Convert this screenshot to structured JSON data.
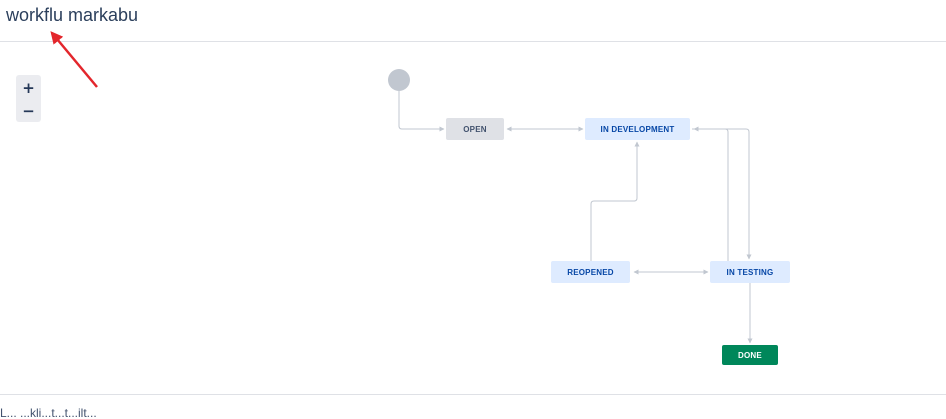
{
  "page": {
    "title": "workflu markabu",
    "footer_text": "L... ...kli...t...t...ilt..."
  },
  "zoom": {
    "zoom_in_label": "+",
    "zoom_out_label": "−"
  },
  "statuses": {
    "open": "OPEN",
    "in_development": "IN DEVELOPMENT",
    "reopened": "REOPENED",
    "in_testing": "IN TESTING",
    "done": "DONE"
  },
  "colors": {
    "todo_bg": "#dfe1e6",
    "in_progress_bg": "#deebff",
    "done_bg": "#00875a",
    "annotation_arrow": "#e3262c",
    "connector": "#c1c7d0"
  },
  "icons": {
    "annotation": "red-arrow-icon",
    "start": "start-circle-icon"
  }
}
